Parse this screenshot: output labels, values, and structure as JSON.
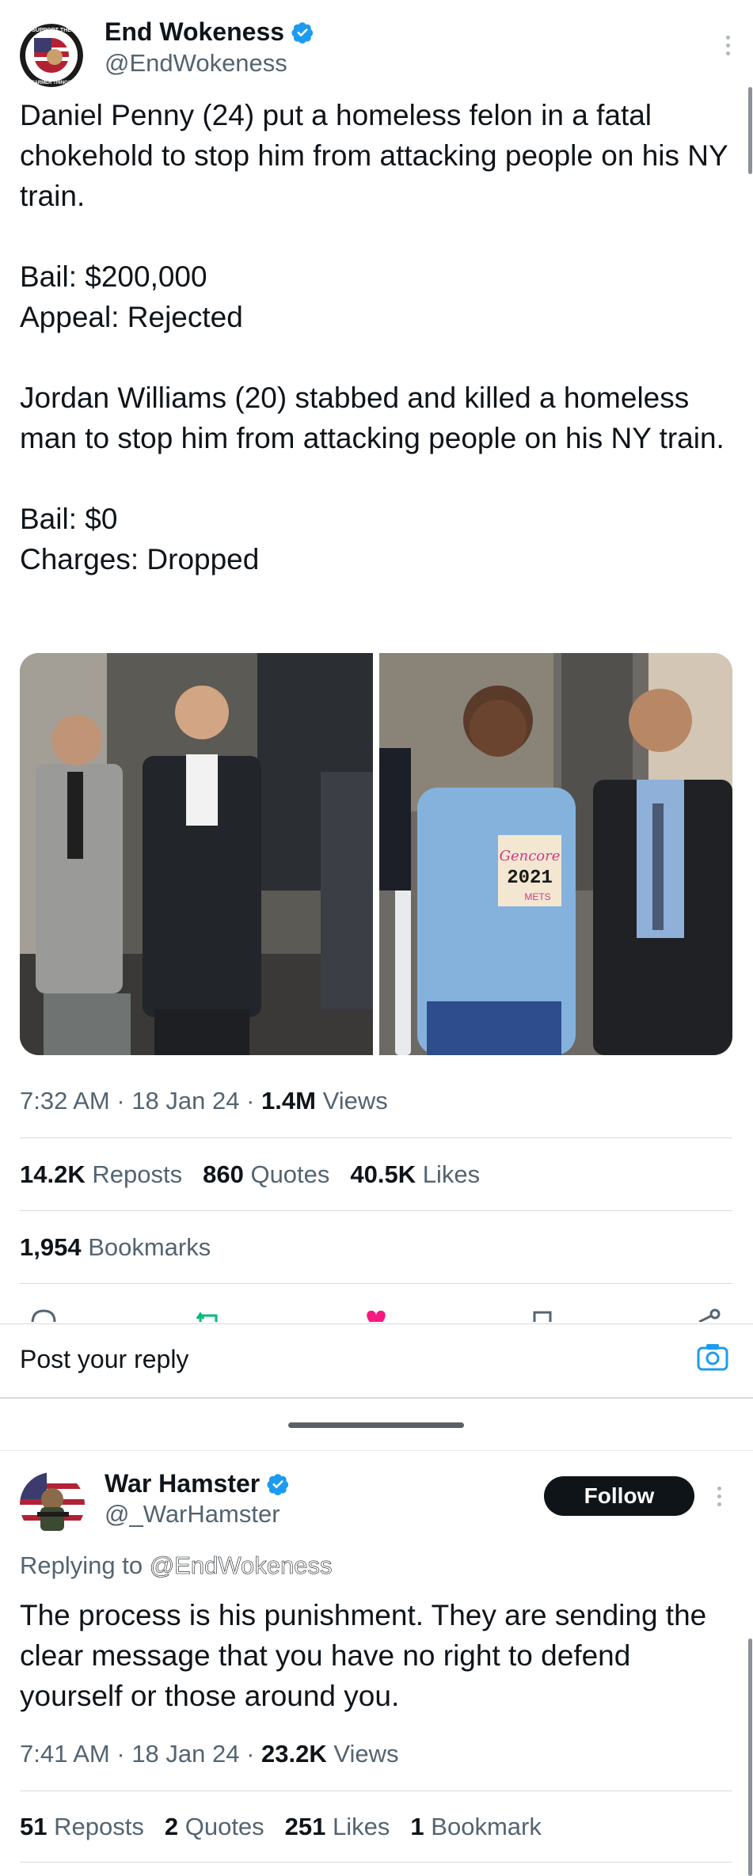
{
  "tweet": {
    "author_name": "End Wokeness",
    "author_handle": "@EndWokeness",
    "text": "Daniel Penny (24) put a homeless felon in a fatal chokehold to stop him from attacking people on his NY train.\n\nBail: $200,000\nAppeal: Rejected\n\nJordan Williams (20) stabbed and killed a homeless man to stop him from attacking people on his NY train.\n\nBail: $0\nCharges: Dropped",
    "hoodie_text": [
      "Gencore",
      "2021",
      "METS"
    ],
    "time": "7:32 AM",
    "date": "18 Jan 24",
    "views_count": "1.4M",
    "views_label": "Views",
    "reposts_count": "14.2K",
    "reposts_label": "Reposts",
    "quotes_count": "860",
    "quotes_label": "Quotes",
    "likes_count": "40.5K",
    "likes_label": "Likes",
    "bookmarks_count": "1,954",
    "bookmarks_label": "Bookmarks",
    "avatar_text": [
      "SUPPORT THE",
      "FARMER THINGS"
    ]
  },
  "reply_bar": {
    "placeholder": "Post your reply"
  },
  "reply": {
    "author_name": "War Hamster",
    "author_handle": "@_WarHamster",
    "follow_label": "Follow",
    "replying_prefix": "Replying to",
    "replying_to": "@EndWokeness",
    "text": "The process is his punishment. They are sending the clear message that you have no right to defend yourself or those around you.",
    "time": "7:41 AM",
    "date": "18 Jan 24",
    "views_count": "23.2K",
    "views_label": "Views",
    "reposts_count": "51",
    "reposts_label": "Reposts",
    "quotes_count": "2",
    "quotes_label": "Quotes",
    "likes_count": "251",
    "likes_label": "Likes",
    "bookmarks_count": "1",
    "bookmarks_label": "Bookmark"
  },
  "colors": {
    "verified": "#1d9bf0",
    "like_active": "#f91880",
    "repost_active": "#00ba7c"
  },
  "icons": [
    "verified-badge-icon",
    "more-icon",
    "reply-icon",
    "repost-icon",
    "like-icon",
    "bookmark-icon",
    "share-icon",
    "camera-icon"
  ]
}
